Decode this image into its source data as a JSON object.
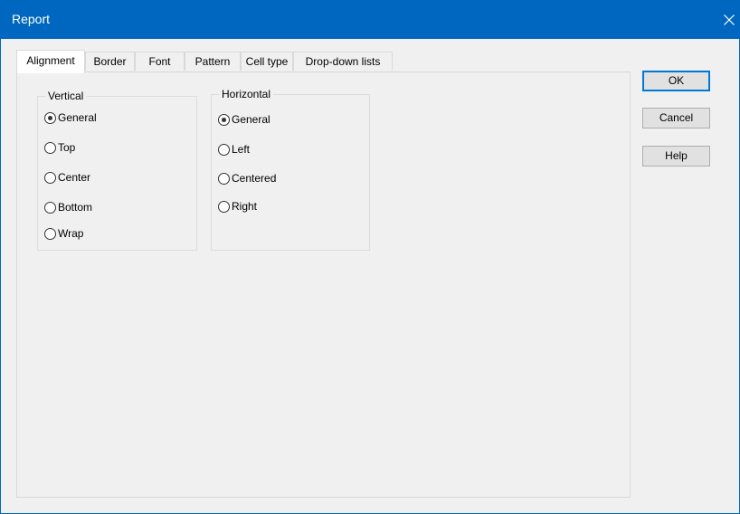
{
  "window": {
    "title": "Report",
    "close_icon": "close-icon"
  },
  "tabs": [
    {
      "label": "Alignment",
      "active": true
    },
    {
      "label": "Border",
      "active": false
    },
    {
      "label": "Font",
      "active": false
    },
    {
      "label": "Pattern",
      "active": false
    },
    {
      "label": "Cell type",
      "active": false
    },
    {
      "label": "Drop-down lists",
      "active": false
    }
  ],
  "vertical_group": {
    "title": "Vertical",
    "options": [
      {
        "label": "General",
        "checked": true
      },
      {
        "label": "Top",
        "checked": false
      },
      {
        "label": "Center",
        "checked": false
      },
      {
        "label": "Bottom",
        "checked": false
      },
      {
        "label": "Wrap",
        "checked": false
      }
    ]
  },
  "horizontal_group": {
    "title": "Horizontal",
    "options": [
      {
        "label": "General",
        "checked": true
      },
      {
        "label": "Left",
        "checked": false
      },
      {
        "label": "Centered",
        "checked": false
      },
      {
        "label": "Right",
        "checked": false
      }
    ]
  },
  "buttons": {
    "ok": "OK",
    "cancel": "Cancel",
    "help": "Help"
  },
  "colors": {
    "titlebar": "#0067c0",
    "dialog_bg": "#f0f0f0",
    "default_button_border": "#0078d7"
  }
}
